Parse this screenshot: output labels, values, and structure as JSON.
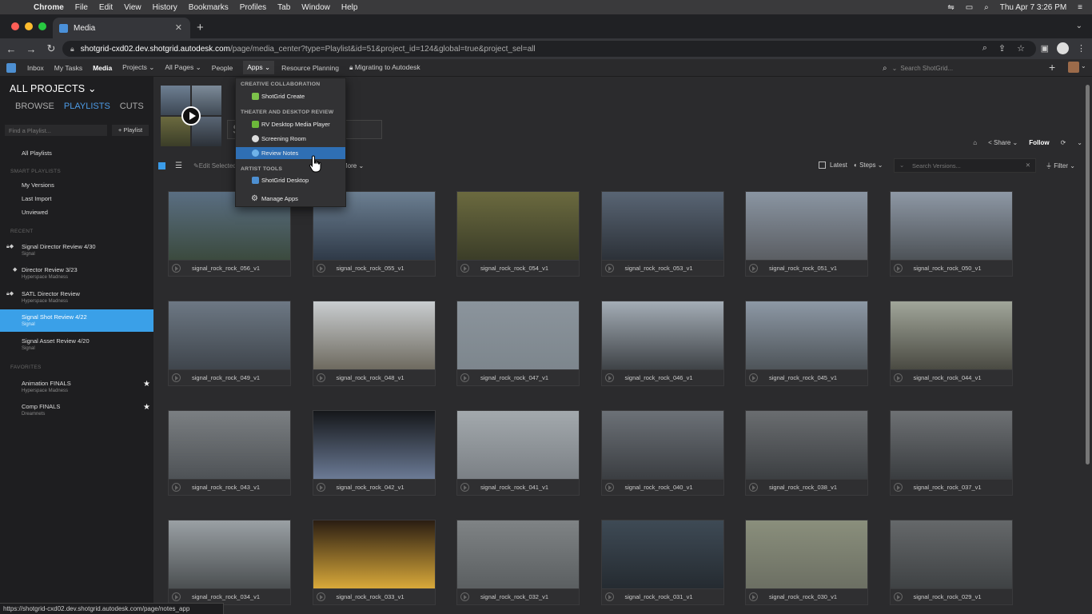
{
  "mac_menu": {
    "app": "Chrome",
    "items": [
      "File",
      "Edit",
      "View",
      "History",
      "Bookmarks",
      "Profiles",
      "Tab",
      "Window",
      "Help"
    ],
    "clock": "Thu Apr 7  3:26 PM"
  },
  "browser": {
    "tab_title": "Media",
    "url_host": "shotgrid-cxd02.dev.shotgrid.autodesk.com",
    "url_path": "/page/media_center?type=Playlist&id=51&project_id=124&global=true&project_sel=all"
  },
  "nav": {
    "items": [
      "Inbox",
      "My Tasks",
      "Media",
      "Projects ⌄",
      "All Pages ⌄",
      "People",
      "Apps ⌄",
      "Resource Planning"
    ],
    "migrating": "Migrating to Autodesk",
    "search_placeholder": "Search ShotGrid..."
  },
  "sidebar": {
    "title": "ALL PROJECTS ⌄",
    "tabs": [
      "BROWSE",
      "PLAYLISTS",
      "CUTS"
    ],
    "search_placeholder": "Find a Playlist...",
    "add_button": "+ Playlist",
    "all_playlists": "All Playlists",
    "smart_header": "SMART PLAYLISTS",
    "smart": [
      "My Versions",
      "Last Import",
      "Unviewed"
    ],
    "recent_header": "RECENT",
    "recent": [
      {
        "name": "Signal Director Review 4/30",
        "sub": "Signal"
      },
      {
        "name": "Director Review 3/23",
        "sub": "Hyperspace Madness"
      },
      {
        "name": "SATL Director Review",
        "sub": "Hyperspace Madness"
      },
      {
        "name": "Signal Shot Review 4/22",
        "sub": "Signal"
      },
      {
        "name": "Signal Asset Review 4/20",
        "sub": "Signal"
      }
    ],
    "fav_header": "FAVORITES",
    "favorites": [
      {
        "name": "Animation FINALS",
        "sub": "Hyperspace Madness"
      },
      {
        "name": "Comp FINALS",
        "sub": "Dreamnets"
      }
    ]
  },
  "header": {
    "title_partial": "S                      ew ...",
    "share": "Share ⌄",
    "follow": "Follow"
  },
  "toolbar": {
    "edit": "Edit Selected",
    "more": "More ⌄",
    "latest": "Latest",
    "steps": "Steps ⌄",
    "search_placeholder": "Search Versions...",
    "filter": "Filter ⌄"
  },
  "apps_menu": {
    "sec1": "CREATIVE COLLABORATION",
    "create": "ShotGrid Create",
    "sec2": "THEATER AND DESKTOP REVIEW",
    "rv": "RV Desktop Media Player",
    "screening": "Screening Room",
    "review_notes": "Review Notes",
    "sec3": "ARTIST TOOLS",
    "desktop": "ShotGrid Desktop",
    "manage": "Manage Apps"
  },
  "versions": [
    "signal_rock_rock_056_v1",
    "signal_rock_rock_055_v1",
    "signal_rock_rock_054_v1",
    "signal_rock_rock_053_v1",
    "signal_rock_rock_051_v1",
    "signal_rock_rock_050_v1",
    "signal_rock_rock_049_v1",
    "signal_rock_rock_048_v1",
    "signal_rock_rock_047_v1",
    "signal_rock_rock_046_v1",
    "signal_rock_rock_045_v1",
    "signal_rock_rock_044_v1",
    "signal_rock_rock_043_v1",
    "signal_rock_rock_042_v1",
    "signal_rock_rock_041_v1",
    "signal_rock_rock_040_v1",
    "signal_rock_rock_038_v1",
    "signal_rock_rock_037_v1",
    "signal_rock_rock_034_v1",
    "signal_rock_rock_033_v1",
    "signal_rock_rock_032_v1",
    "signal_rock_rock_031_v1",
    "signal_rock_rock_030_v1",
    "signal_rock_rock_029_v1"
  ],
  "thumb_colors": [
    [
      "#5a6e82",
      "#3b4a3e"
    ],
    [
      "#6c7f92",
      "#2f3a48"
    ],
    [
      "#6b6a3f",
      "#3b3d28"
    ],
    [
      "#596574",
      "#2c3138"
    ],
    [
      "#8a95a2",
      "#5b5e63"
    ],
    [
      "#8e98a5",
      "#4d5257"
    ],
    [
      "#6d7884",
      "#3f454c"
    ],
    [
      "#c9cdd0",
      "#6e6a5f"
    ],
    [
      "#8b949c",
      "#7d868d"
    ],
    [
      "#a4adb6",
      "#3f4347"
    ],
    [
      "#8d98a5",
      "#4e5459"
    ],
    [
      "#a1a69a",
      "#4a4a42"
    ],
    [
      "#7b7f82",
      "#4e5256"
    ],
    [
      "#15171a",
      "#6b7a95"
    ],
    [
      "#a3a9ad",
      "#7b8085"
    ],
    [
      "#6c7177",
      "#3b3e42"
    ],
    [
      "#6a6d70",
      "#3c3f42"
    ],
    [
      "#6e7174",
      "#3a3d40"
    ],
    [
      "#9aa0a4",
      "#4b4f51"
    ],
    [
      "#2a1d12",
      "#d9a93a"
    ],
    [
      "#7f8385",
      "#5b5f61"
    ],
    [
      "#3e4a55",
      "#252b31"
    ],
    [
      "#8a8f7c",
      "#6c6f63"
    ],
    [
      "#65686a",
      "#3f4244"
    ]
  ],
  "status_url": "https://shotgrid-cxd02.dev.shotgrid.autodesk.com/page/notes_app"
}
